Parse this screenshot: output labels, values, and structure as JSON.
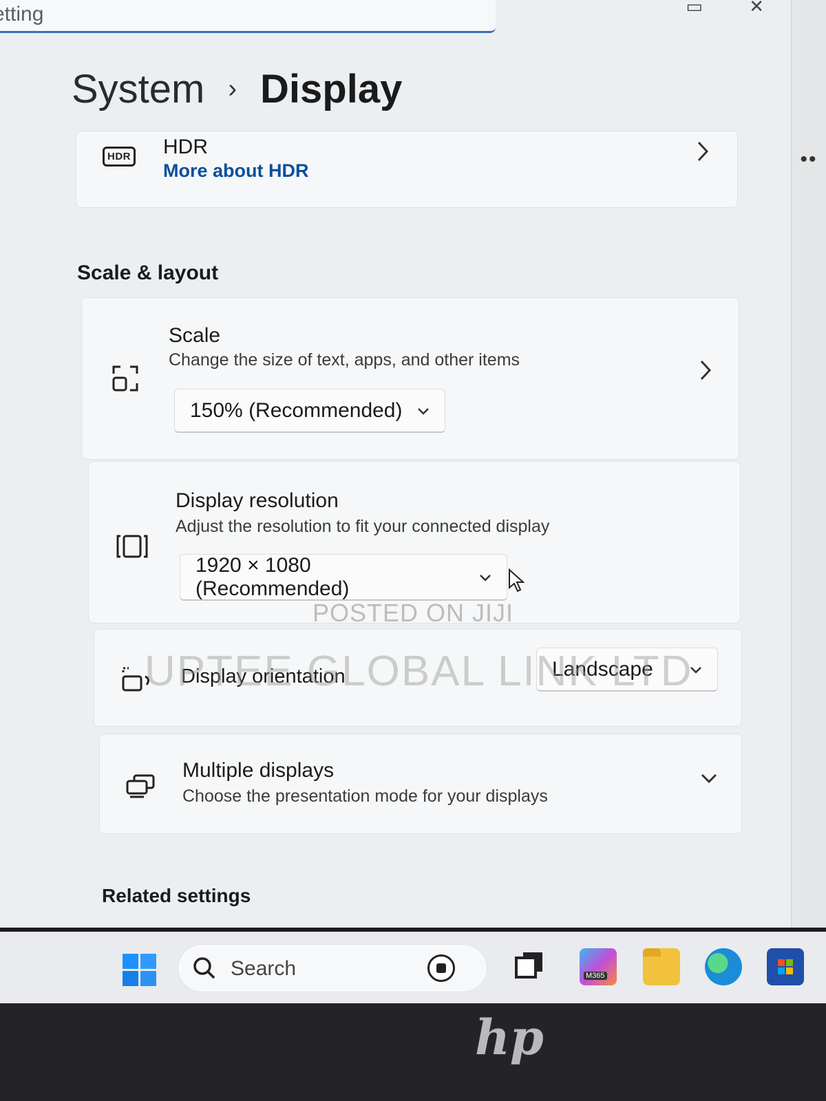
{
  "window": {
    "search_text": "etting",
    "controls": [
      "▭",
      "✕"
    ],
    "side_overflow": "••"
  },
  "breadcrumb": {
    "parent": "System",
    "separator": "›",
    "current": "Display"
  },
  "hdr": {
    "badge": "HDR",
    "title": "HDR",
    "link": "More about HDR"
  },
  "scale_layout": {
    "heading": "Scale & layout",
    "scale": {
      "title": "Scale",
      "description": "Change the size of text, apps, and other items",
      "value": "150% (Recommended)"
    },
    "resolution": {
      "title": "Display resolution",
      "description": "Adjust the resolution to fit your connected display",
      "value": "1920 × 1080 (Recommended)"
    },
    "orientation": {
      "title": "Display orientation",
      "value": "Landscape"
    },
    "multiple_displays": {
      "title": "Multiple displays",
      "description": "Choose the presentation mode for your displays"
    }
  },
  "related": {
    "heading": "Related settings"
  },
  "watermarks": {
    "posted": "POSTED ON JIJI",
    "company": "UPTEE GLOBAL LINK LTD"
  },
  "taskbar": {
    "search_label": "Search",
    "m365_badge": "M365"
  },
  "device": {
    "brand_logo": "hp"
  },
  "colors": {
    "accent": "#0a4f9e",
    "start_blue": "#1e90ff"
  }
}
